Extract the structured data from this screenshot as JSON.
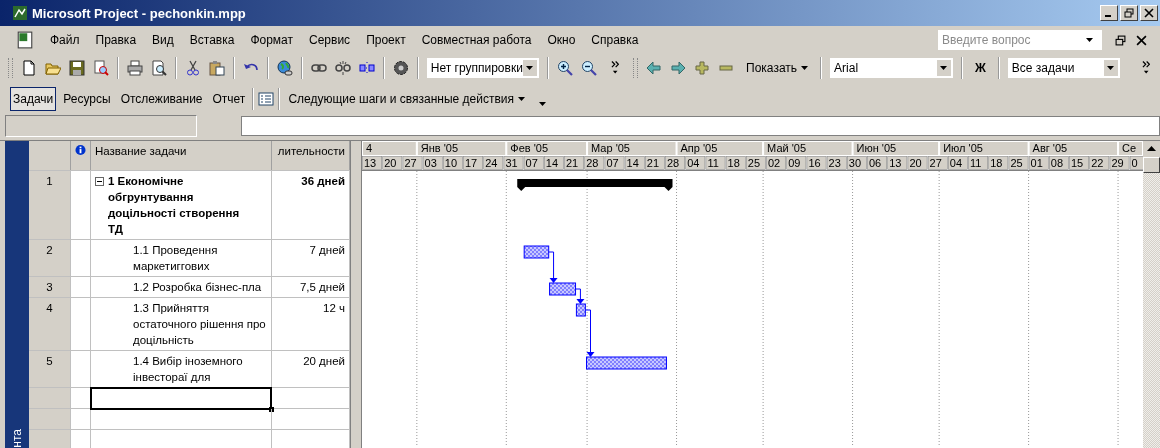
{
  "window": {
    "title": "Microsoft Project - pechonkin.mpp"
  },
  "menu": {
    "items": [
      "Файл",
      "Правка",
      "Вид",
      "Вставка",
      "Формат",
      "Сервис",
      "Проект",
      "Совместная работа",
      "Окно",
      "Справка"
    ],
    "help_field": {
      "placeholder": "Введите вопрос"
    }
  },
  "toolbar": {
    "grouping": "Нет группировки",
    "show": "Показать",
    "font": "Arial",
    "bold": "Ж",
    "filter": "Все задачи"
  },
  "guide_bar": {
    "tabs": [
      {
        "label": "Задачи",
        "selected": true
      },
      {
        "label": "Ресурсы",
        "selected": false
      },
      {
        "label": "Отслеживание",
        "selected": false
      },
      {
        "label": "Отчет",
        "selected": false
      }
    ],
    "steps": "Следующие шаги и связанные действия"
  },
  "view_bar": {
    "label": "нта"
  },
  "table": {
    "columns": [
      "Название задачи",
      "лительности"
    ],
    "tasks": [
      {
        "id": "1",
        "name": "1 Економічне обгрунтування доцільності створення ТД",
        "duration": "36 дней",
        "expanded": true,
        "children": [
          {
            "id": "2",
            "name": "1.1 Проведення маркетиггових",
            "duration": "7 дней"
          },
          {
            "id": "3",
            "name": "1.2 Розробка бізнес-пла",
            "duration": "7,5 дней"
          },
          {
            "id": "4",
            "name": "1.3 Прийняття остаточного рішення про доцільність",
            "duration": "12 ч"
          },
          {
            "id": "5",
            "name": "1.4 Вибір іноземного інвестораї для",
            "duration": "20 дней"
          }
        ]
      }
    ],
    "empty_rows": [
      {
        "selected": true
      },
      {
        "selected": false
      },
      {
        "selected": false
      }
    ]
  },
  "timescale": {
    "months": [
      "4",
      "Янв '05",
      "Фев '05",
      "Мар '05",
      "Апр '05",
      "Май '05",
      "Июн '05",
      "Июл '05",
      "Авг '05",
      "Се"
    ],
    "weeks": [
      "13",
      "20",
      "27",
      "03",
      "10",
      "17",
      "24",
      "31",
      "07",
      "14",
      "21",
      "28",
      "07",
      "14",
      "21",
      "28",
      "04",
      "11",
      "18",
      "25",
      "02",
      "09",
      "16",
      "23",
      "30",
      "06",
      "13",
      "20",
      "27",
      "04",
      "11",
      "18",
      "25",
      "01",
      "08",
      "15",
      "22",
      "29",
      "0"
    ]
  }
}
